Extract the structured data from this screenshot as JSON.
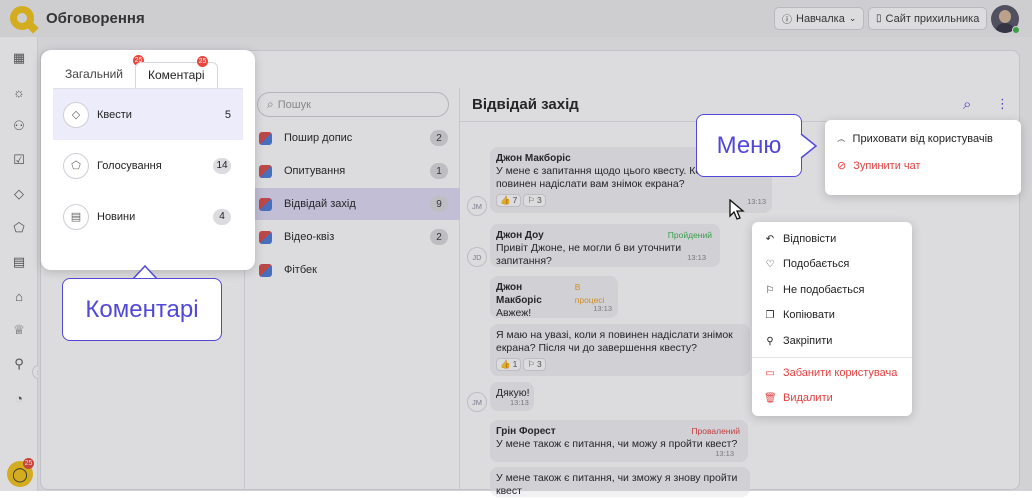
{
  "header": {
    "title": "Обговорення",
    "learning_label": "Навчалка",
    "site_label": "Сайт прихильника"
  },
  "sidebar": {
    "icons": [
      "building-icon",
      "bulb-icon",
      "users-icon",
      "clipboard-icon",
      "diamond-icon",
      "eraser-icon",
      "list-icon",
      "tag-icon",
      "trophy-icon",
      "hierarchy-icon",
      "pie-chart-icon"
    ],
    "chat_badge": "25",
    "collapse_label": "»"
  },
  "popover": {
    "tabs": [
      {
        "label": "Загальний",
        "badge": "25"
      },
      {
        "label": "Коментарі",
        "badge": "25"
      }
    ],
    "items": [
      {
        "label": "Квести",
        "count": "5",
        "icon": "diamond-icon"
      },
      {
        "label": "Голосування",
        "count": "14",
        "icon": "eraser-icon"
      },
      {
        "label": "Новини",
        "count": "4",
        "icon": "news-icon"
      }
    ]
  },
  "callouts": {
    "comments": "Коментарі",
    "menu": "Меню"
  },
  "topics": {
    "search_placeholder": "Пошук",
    "items": [
      {
        "label": "Пошир допис",
        "count": "2"
      },
      {
        "label": "Опитування",
        "count": "1"
      },
      {
        "label": "Відвідай захід",
        "count": "9"
      },
      {
        "label": "Відео-квіз",
        "count": "2"
      },
      {
        "label": "Фітбек",
        "count": ""
      }
    ]
  },
  "chat": {
    "title": "Відвідай захід",
    "messages": [
      {
        "initials": "JM",
        "author": "Джон Макборіс",
        "status": "",
        "text": "У мене є запитання щодо цього квесту. Коли я повинен надіслати вам знімок екрана?",
        "time": "13:13",
        "likes": "7",
        "dislikes": "3"
      },
      {
        "initials": "JD",
        "author": "Джон Доу",
        "status": "Пройдений",
        "text": "Привіт Джоне, не могли б ви уточнити запитання?",
        "time": "13:13"
      },
      {
        "initials": "",
        "author": "Джон Макборіс",
        "status": "В процесі",
        "text": "Авжеж!",
        "time": "13:13"
      },
      {
        "initials": "",
        "author": "",
        "status": "",
        "text": "Я маю на увазі, коли я повинен надіслати знімок екрана? Після чи до завершення квесту?",
        "time": "",
        "likes": "1",
        "dislikes": "3"
      },
      {
        "initials": "JM",
        "author": "",
        "status": "",
        "text": "Дякую!",
        "time": "13:13"
      },
      {
        "initials": "",
        "author": "Грін Форест",
        "status": "Провалений",
        "text": "У мене також є питання, чи можу я пройти квест?",
        "time": "13:13"
      },
      {
        "initials": "",
        "author": "",
        "status": "",
        "text": "У мене також є питання, чи зможу я знову пройти квест"
      }
    ]
  },
  "context_menu": {
    "items": [
      {
        "label": "Відповісти",
        "icon": "reply-icon"
      },
      {
        "label": "Подобається",
        "icon": "thumbs-up-icon"
      },
      {
        "label": "Не подобається",
        "icon": "thumbs-down-icon"
      },
      {
        "label": "Копіювати",
        "icon": "copy-icon"
      },
      {
        "label": "Закріпити",
        "icon": "pin-icon"
      }
    ],
    "danger_items": [
      {
        "label": "Забанити користувача",
        "icon": "ban-icon"
      },
      {
        "label": "Видалити",
        "icon": "trash-icon"
      }
    ]
  },
  "chat_menu": {
    "items": [
      {
        "label": "Приховати від користувачів",
        "icon": "eye-closed-icon"
      },
      {
        "label": "Зупинити чат",
        "icon": "stop-icon"
      }
    ]
  },
  "colors": {
    "accent": "#5248d8",
    "brand": "#f5c518",
    "danger": "#e04040",
    "passed": "#3cb34a",
    "in_progress": "#f0a020",
    "failed": "#e04040"
  }
}
